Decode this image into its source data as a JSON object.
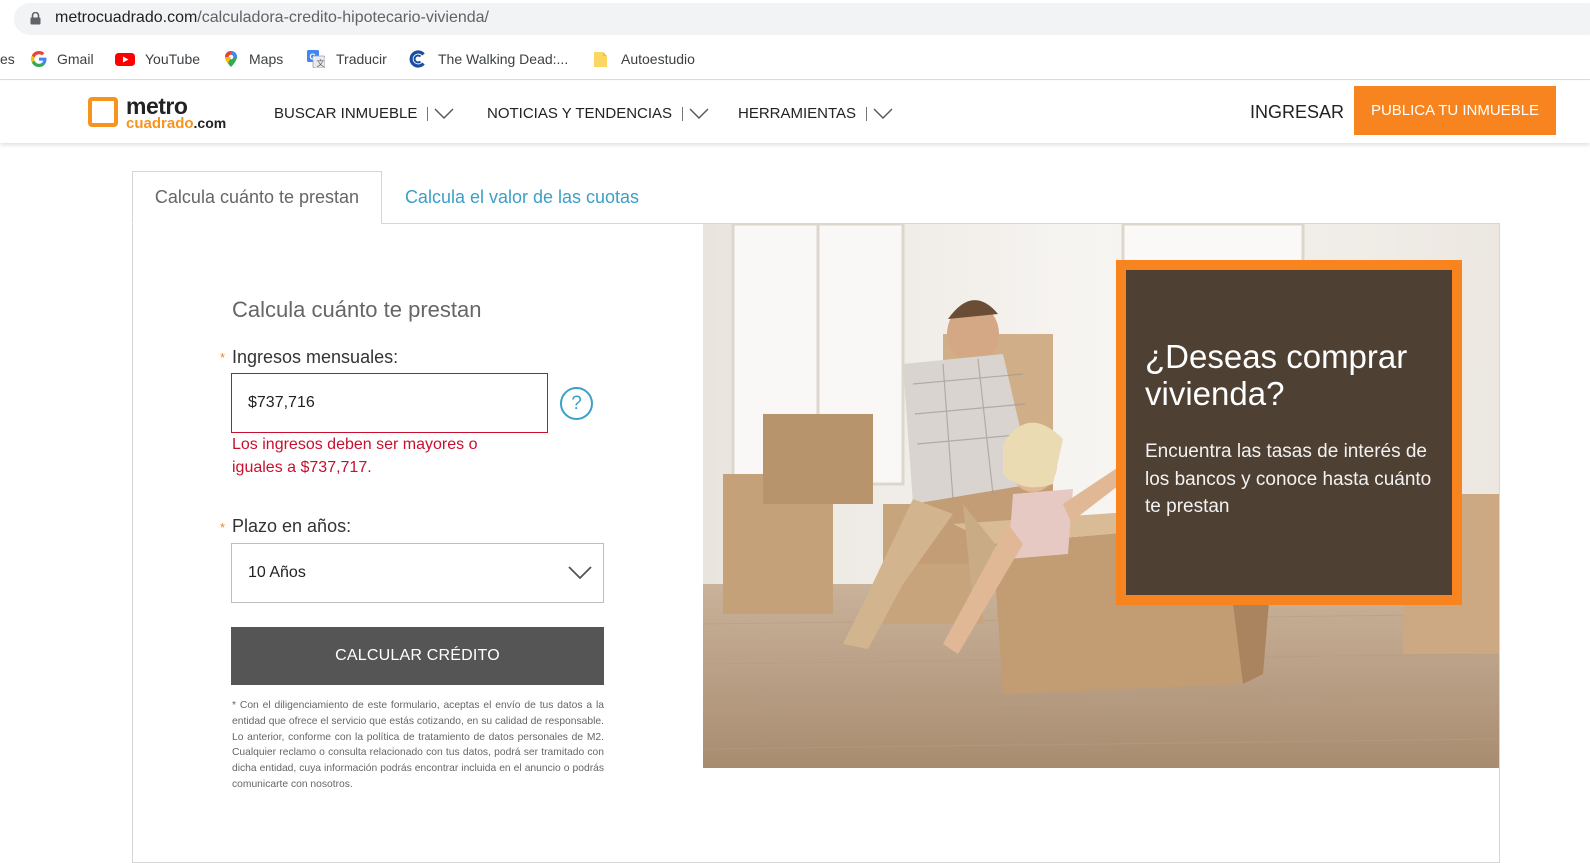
{
  "browser": {
    "url_domain": "metrocuadrado.com",
    "url_path": "/calculadora-credito-hipotecario-vivienda/",
    "bookmarks": [
      {
        "label": "es",
        "icon": "bookmark-fragment"
      },
      {
        "label": "Gmail",
        "icon": "google-icon"
      },
      {
        "label": "YouTube",
        "icon": "youtube-icon"
      },
      {
        "label": "Maps",
        "icon": "maps-icon"
      },
      {
        "label": "Traducir",
        "icon": "translate-icon"
      },
      {
        "label": "The Walking Dead:...",
        "icon": "site-c-icon"
      },
      {
        "label": "Autoestudio",
        "icon": "folder-icon"
      }
    ]
  },
  "header": {
    "logo_top": "metro",
    "logo_bottom": "cuadrado",
    "logo_suffix": ".com",
    "nav": [
      "BUSCAR INMUEBLE",
      "NOTICIAS Y TENDENCIAS",
      "HERRAMIENTAS"
    ],
    "login": "INGRESAR",
    "cta": "PUBLICA TU INMUEBLE"
  },
  "tabs": {
    "active": "Calcula cuánto te prestan",
    "inactive": "Calcula el valor de las cuotas"
  },
  "form": {
    "title": "Calcula cuánto te prestan",
    "required_mark": "*",
    "income_label": "Ingresos mensuales:",
    "income_value": "$737,716",
    "help": "?",
    "error": "Los ingresos deben ser mayores o iguales a $737,717.",
    "term_label": "Plazo en años:",
    "term_value": "10 Años",
    "submit": "CALCULAR CRÉDITO",
    "disclaimer": "* Con el diligenciamiento de este formulario, aceptas el envío de tus datos a la entidad que ofrece el servicio que estás cotizando, en su calidad de responsable. Lo anterior, conforme con la política de tratamiento de datos personales de M2. Cualquier reclamo o consulta relacionado con tus datos, podrá ser tramitado con dicha entidad, cuya información podrás encontrar incluida en el anuncio o podrás comunicarte con nosotros."
  },
  "promo": {
    "title": "¿Deseas comprar vivienda?",
    "text": "Encuentra las tasas de interés de los bancos y conoce hasta cuánto te prestan"
  },
  "colors": {
    "accent": "#f7841e",
    "link": "#3b9fc7",
    "error": "#c8102e",
    "button": "#555555"
  }
}
